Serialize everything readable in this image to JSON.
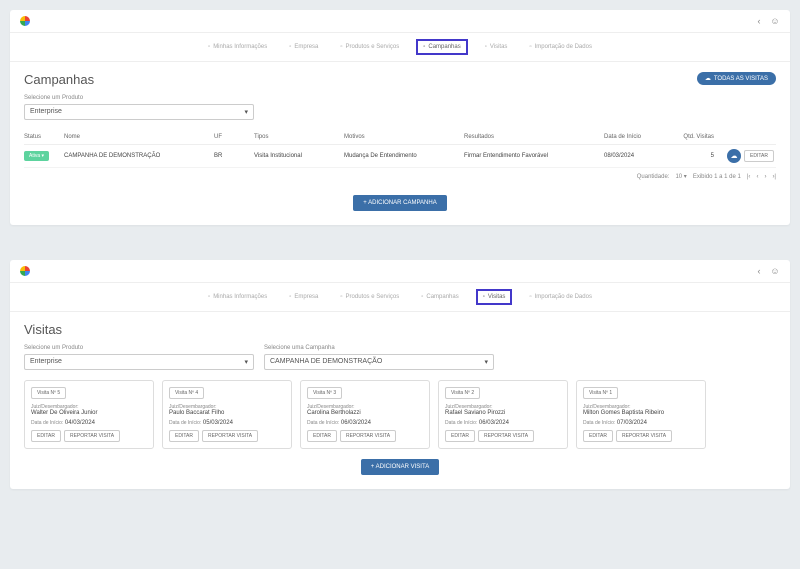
{
  "topTabs": [
    "Minhas Informações",
    "Empresa",
    "Produtos e Serviços",
    "Campanhas",
    "Visitas",
    "Importação de Dados"
  ],
  "panel1": {
    "activeTab": 3,
    "title": "Campanhas",
    "pillLabel": "TODAS AS VISITAS",
    "selectLabel": "Selecione um Produto",
    "selectValue": "Enterprise",
    "headers": {
      "status": "Status",
      "nome": "Nome",
      "uf": "UF",
      "tipos": "Tipos",
      "motivos": "Motivos",
      "resultados": "Resultados",
      "data": "Data de Início",
      "qtd": "Qtd. Visitas"
    },
    "row": {
      "status": "Ativa",
      "nome": "CAMPANHA DE DEMONSTRAÇÃO",
      "uf": "BR",
      "tipos": "Visita Institucional",
      "motivos": "Mudança De Entendimento",
      "resultados": "Firmar Entendimento Favorável",
      "data": "08/03/2024",
      "qtd": "5",
      "edit": "EDITAR"
    },
    "pager": {
      "qtd": "Quantidade:",
      "qv": "10",
      "ex": "Exibido 1 a 1 de 1"
    },
    "addBtn": "+  ADICIONAR CAMPANHA"
  },
  "panel2": {
    "activeTab": 4,
    "title": "Visitas",
    "sel1Label": "Selecione um Produto",
    "sel1Value": "Enterprise",
    "sel2Label": "Selecione uma Campanha",
    "sel2Value": "CAMPANHA DE DEMONSTRAÇÃO",
    "cardLabels": {
      "juiz": "Juiz/Desembargador:",
      "data": "Data de Início:",
      "edit": "EDITAR",
      "rep": "REPORTAR VISITA"
    },
    "cards": [
      {
        "num": "Visita Nº 5",
        "juiz": "Walter De Oliveira Junior",
        "data": "04/03/2024"
      },
      {
        "num": "Visita Nº 4",
        "juiz": "Paulo Baccarat Filho",
        "data": "05/03/2024"
      },
      {
        "num": "Visita Nº 3",
        "juiz": "Carolina Bertholazzi",
        "data": "06/03/2024"
      },
      {
        "num": "Visita Nº 2",
        "juiz": "Rafael Saviano Pirozzi",
        "data": "06/03/2024"
      },
      {
        "num": "Visita Nº 1",
        "juiz": "Milton Gomes Baptista Ribeiro",
        "data": "07/03/2024"
      }
    ],
    "addBtn": "+  ADICIONAR VISITA"
  }
}
